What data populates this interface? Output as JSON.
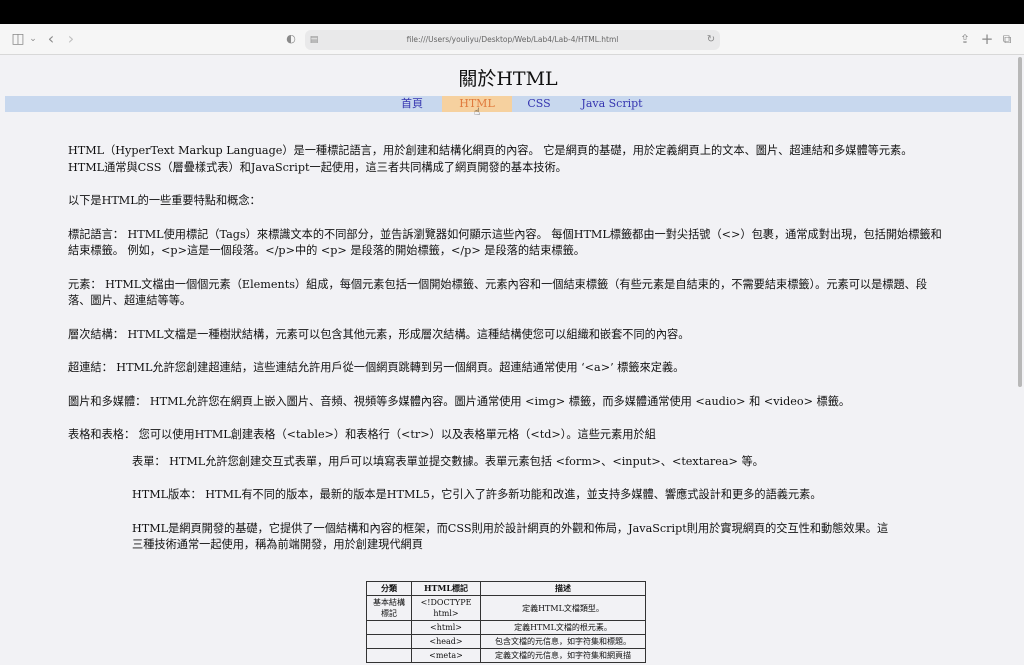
{
  "browser": {
    "url": "file:///Users/youliyu/Desktop/Web/Lab4/Lab-4/HTML.html"
  },
  "page": {
    "title": "關於HTML",
    "nav": [
      "首頁",
      "HTML",
      "CSS",
      "Java Script"
    ],
    "paragraphs": [
      "HTML（HyperText Markup Language）是一種標記語言，用於創建和結構化網頁的內容。 它是網頁的基礎，用於定義網頁上的文本、圖片、超連結和多媒體等元素。 HTML通常與CSS（層疊樣式表）和JavaScript一起使用，這三者共同構成了網頁開發的基本技術。",
      "以下是HTML的一些重要特點和概念：",
      "標記語言： HTML使用標記（Tags）來標識文本的不同部分，並告訴瀏覽器如何顯示這些內容。 每個HTML標籤都由一對尖括號（<>）包裹，通常成對出現，包括開始標籤和結束標籤。 例如，<p>這是一個段落。</p>中的 <p> 是段落的開始標籤，</p> 是段落的結束標籤。",
      "元素： HTML文檔由一個個元素（Elements）組成，每個元素包括一個開始標籤、元素內容和一個結束標籤（有些元素是自結束的，不需要結束標籤）。元素可以是標題、段落、圖片、超連結等等。",
      "層次結構： HTML文檔是一種樹狀結構，元素可以包含其他元素，形成層次結構。這種結構使您可以組織和嵌套不同的內容。",
      "超連結： HTML允許您創建超連結，這些連結允許用戶從一個網頁跳轉到另一個網頁。超連結通常使用 ‘<a>’ 標籤來定義。",
      "圖片和多媒體： HTML允許您在網頁上嵌入圖片、音頻、視頻等多媒體內容。圖片通常使用 <img> 標籤，而多媒體通常使用 <audio> 和 <video> 標籤。",
      "表格和表格： 您可以使用HTML創建表格（<table>）和表格行（<tr>）以及表格單元格（<td>）。這些元素用於組"
    ],
    "indented": [
      "表單： HTML允許您創建交互式表單，用戶可以填寫表單並提交數據。表單元素包括 <form>、<input>、<textarea> 等。",
      "HTML版本： HTML有不同的版本，最新的版本是HTML5，它引入了許多新功能和改進，並支持多媒體、響應式設計和更多的語義元素。",
      "HTML是網頁開發的基礎，它提供了一個結構和內容的框架，而CSS則用於設計網頁的外觀和佈局，JavaScript則用於實現網頁的交互性和動態效果。這三種技術通常一起使用，稱為前端開發，用於創建現代網頁"
    ],
    "table": {
      "headers": [
        "分類",
        "HTML標記",
        "描述"
      ],
      "rows": [
        [
          "基本結構標記",
          "<!DOCTYPE html>",
          "定義HTML文檔類型。"
        ],
        [
          "",
          "<html>",
          "定義HTML文檔的根元素。"
        ],
        [
          "",
          "<head>",
          "包含文檔的元信息，如字符集和標題。"
        ],
        [
          "",
          "<meta>",
          "定義文檔的元信息，如字符集和網頁描"
        ]
      ]
    }
  }
}
